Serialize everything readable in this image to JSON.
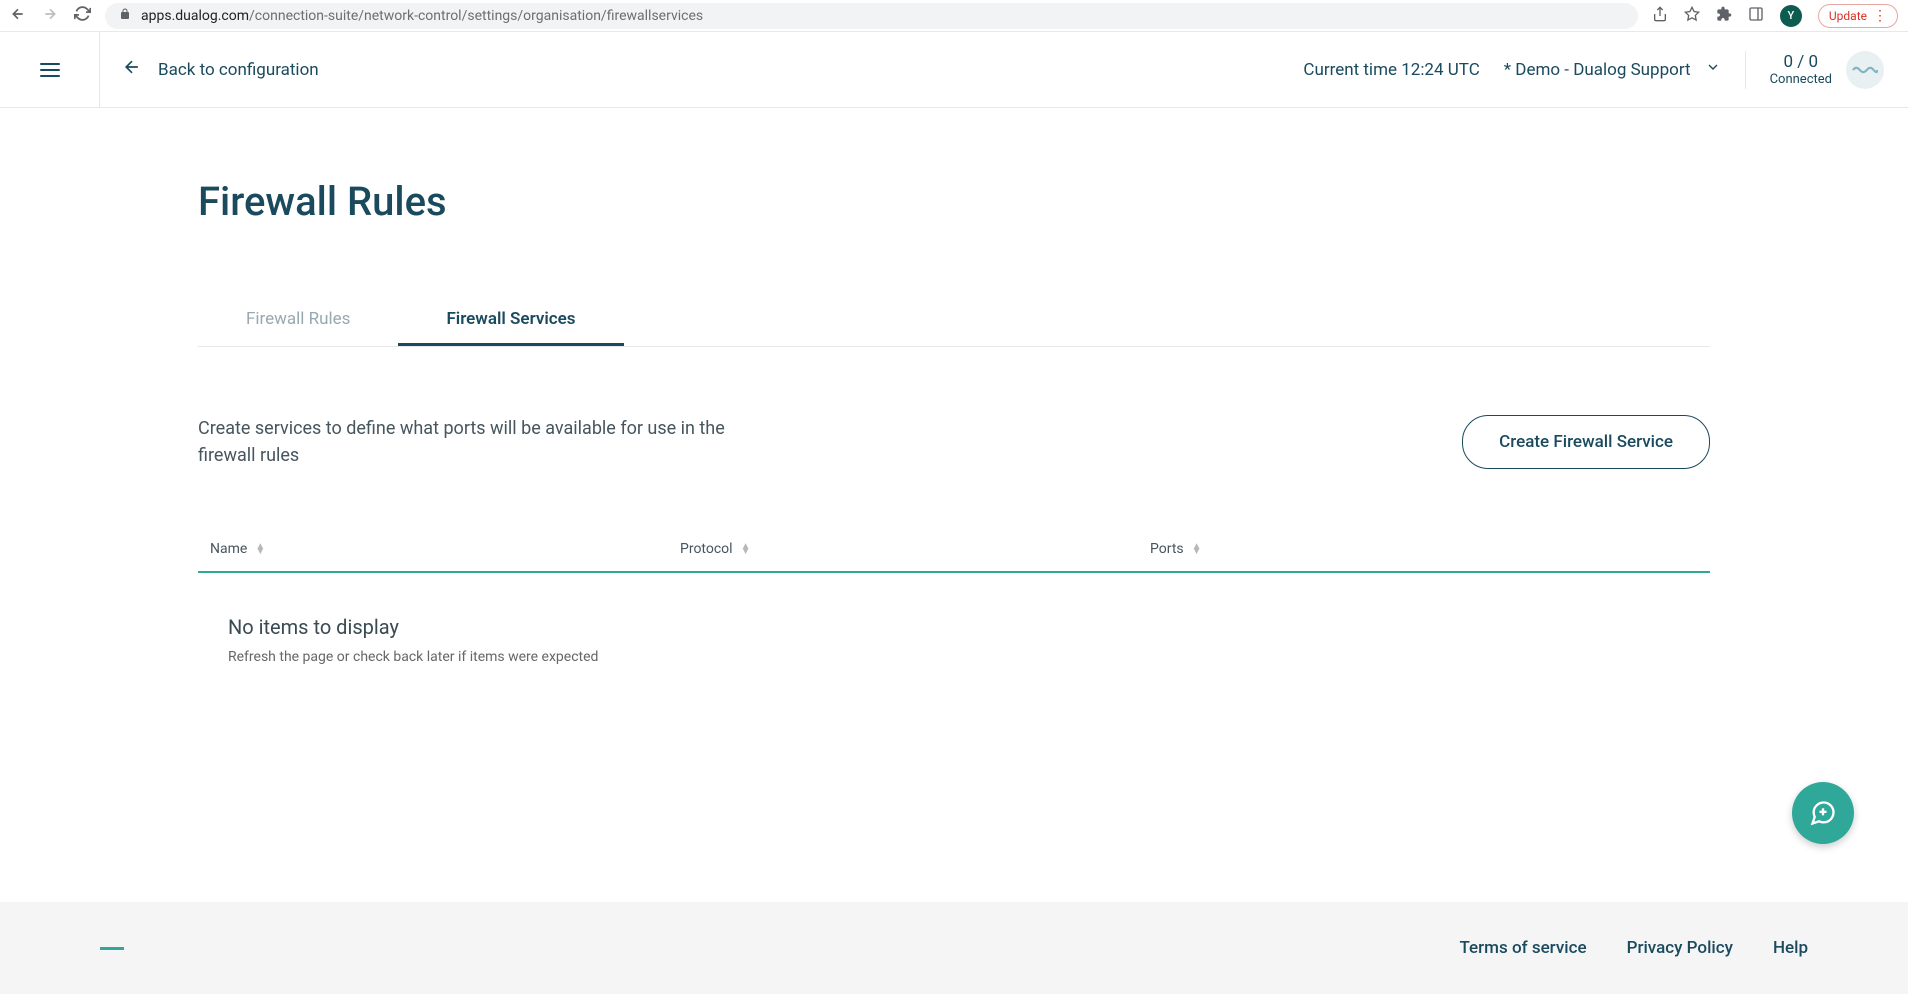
{
  "browser": {
    "url_domain": "apps.dualog.com",
    "url_path": "/connection-suite/network-control/settings/organisation/firewallservices",
    "avatar_letter": "Y",
    "update_label": "Update"
  },
  "header": {
    "back_label": "Back to configuration",
    "current_time": "Current time 12:24 UTC",
    "org_name": "* Demo - Dualog Support",
    "sync_count": "0 / 0",
    "connected_label": "Connected"
  },
  "page": {
    "title": "Firewall Rules"
  },
  "tabs": [
    {
      "label": "Firewall Rules",
      "active": false
    },
    {
      "label": "Firewall Services",
      "active": true
    }
  ],
  "section": {
    "description": "Create services to define what ports will be available for use in the firewall rules",
    "create_button": "Create Firewall Service"
  },
  "table": {
    "columns": {
      "name": "Name",
      "protocol": "Protocol",
      "ports": "Ports"
    },
    "empty_title": "No items to display",
    "empty_sub": "Refresh the page or check back later if items were expected"
  },
  "footer": {
    "terms": "Terms of service",
    "privacy": "Privacy Policy",
    "help": "Help"
  }
}
